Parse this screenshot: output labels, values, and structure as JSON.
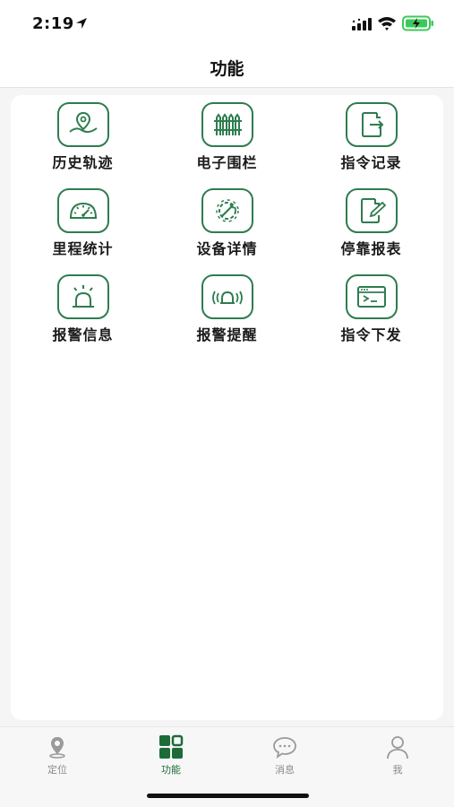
{
  "status": {
    "time": "2:19"
  },
  "nav": {
    "title": "功能"
  },
  "features": [
    {
      "label": "历史轨迹",
      "icon": "map-pin-track-icon"
    },
    {
      "label": "电子围栏",
      "icon": "fence-icon"
    },
    {
      "label": "指令记录",
      "icon": "command-record-icon"
    },
    {
      "label": "里程统计",
      "icon": "speedometer-icon"
    },
    {
      "label": "设备详情",
      "icon": "gear-wrench-icon"
    },
    {
      "label": "停靠报表",
      "icon": "document-pencil-icon"
    },
    {
      "label": "报警信息",
      "icon": "alarm-light-icon"
    },
    {
      "label": "报警提醒",
      "icon": "alarm-bell-waves-icon"
    },
    {
      "label": "指令下发",
      "icon": "terminal-icon"
    }
  ],
  "tabs": [
    {
      "label": "定位",
      "icon": "location-pin-icon",
      "active": false
    },
    {
      "label": "功能",
      "icon": "grid-apps-icon",
      "active": true
    },
    {
      "label": "消息",
      "icon": "chat-bubble-icon",
      "active": false
    },
    {
      "label": "我",
      "icon": "user-icon",
      "active": false
    }
  ],
  "colors": {
    "accent": "#2e7d4f",
    "tab_active": "#1e6b3a",
    "tab_inactive": "#8a8a8a"
  }
}
